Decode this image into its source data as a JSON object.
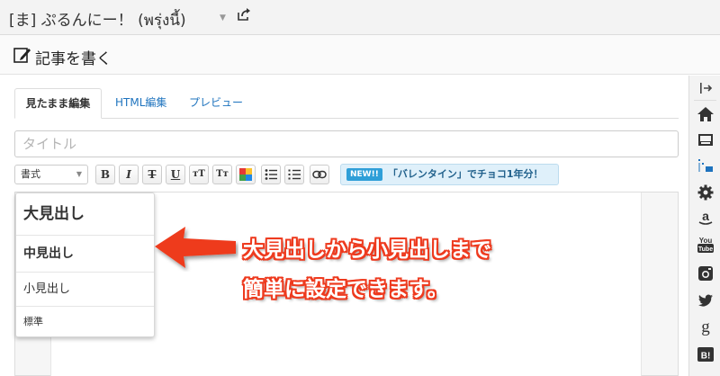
{
  "topbar": {
    "blog_title": "[ま] ぷるんにー！ (พรุ่งนี้)"
  },
  "editor_header": {
    "title": "記事を書く"
  },
  "tabs": [
    {
      "label": "見たまま編集"
    },
    {
      "label": "HTML編集"
    },
    {
      "label": "プレビュー"
    }
  ],
  "title_input": {
    "placeholder": "タイトル",
    "value": ""
  },
  "toolbar": {
    "format_select": "書式",
    "bold": "B",
    "italic": "I",
    "strike": "T",
    "underline": "U",
    "font_up": "тT",
    "font_down": "Tт",
    "banner_badge": "NEW!!",
    "banner_text": "「バレンタイン」でチョコ1年分！"
  },
  "heading_menu": {
    "h1": "大見出し",
    "h2": "中見出し",
    "h3": "小見出し",
    "standard": "標準"
  },
  "annotation": {
    "line1": "大見出しから小見出しまで",
    "line2": "簡単に設定できます。"
  },
  "sidebar": {
    "youtube_label": "You",
    "youtube_sub": "Tube",
    "google_label": "g",
    "hatena_label": "B!"
  },
  "colors": {
    "link": "#1e73be",
    "annotation_red": "#ee3a1e",
    "banner_bg": "#dff0fa",
    "badge_blue": "#2f9fd8"
  }
}
